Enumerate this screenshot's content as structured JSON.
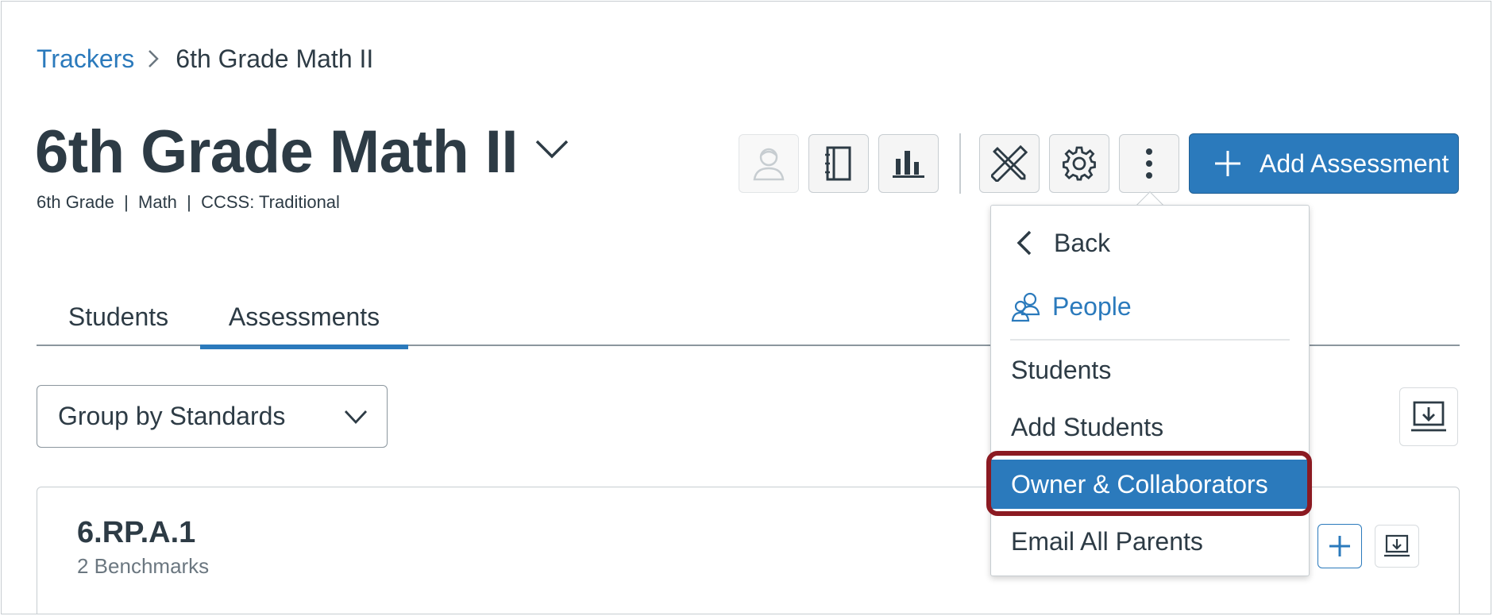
{
  "breadcrumb": {
    "root": "Trackers",
    "current": "6th Grade Math II"
  },
  "header": {
    "title": "6th Grade Math II",
    "subtitle": "6th Grade  |  Math  |  CCSS: Traditional"
  },
  "toolbar": {
    "buttons": [
      {
        "icon": "student-view-icon",
        "disabled": true
      },
      {
        "icon": "notebook-icon",
        "disabled": false
      },
      {
        "icon": "bar-chart-icon",
        "disabled": false
      },
      {
        "icon": "ruler-pencil-icon",
        "disabled": false
      },
      {
        "icon": "gear-icon",
        "disabled": false
      },
      {
        "icon": "more-vertical-icon",
        "disabled": false
      }
    ],
    "add_label": "Add Assessment"
  },
  "tabs": [
    {
      "label": "Students",
      "active": false
    },
    {
      "label": "Assessments",
      "active": true
    }
  ],
  "group_select": {
    "value": "Group by Standards"
  },
  "standard_card": {
    "code": "6.RP.A.1",
    "benchmarks": "2 Benchmarks"
  },
  "menu": {
    "back": "Back",
    "section": "People",
    "items": [
      {
        "label": "Students",
        "highlighted": false
      },
      {
        "label": "Add Students",
        "highlighted": false
      },
      {
        "label": "Owner & Collaborators",
        "highlighted": true
      },
      {
        "label": "Email All Parents",
        "highlighted": false
      }
    ]
  },
  "colors": {
    "accent": "#2b7abc",
    "text": "#2d3b45",
    "muted": "#6b7780",
    "highlight_ring": "#8b1a22"
  }
}
